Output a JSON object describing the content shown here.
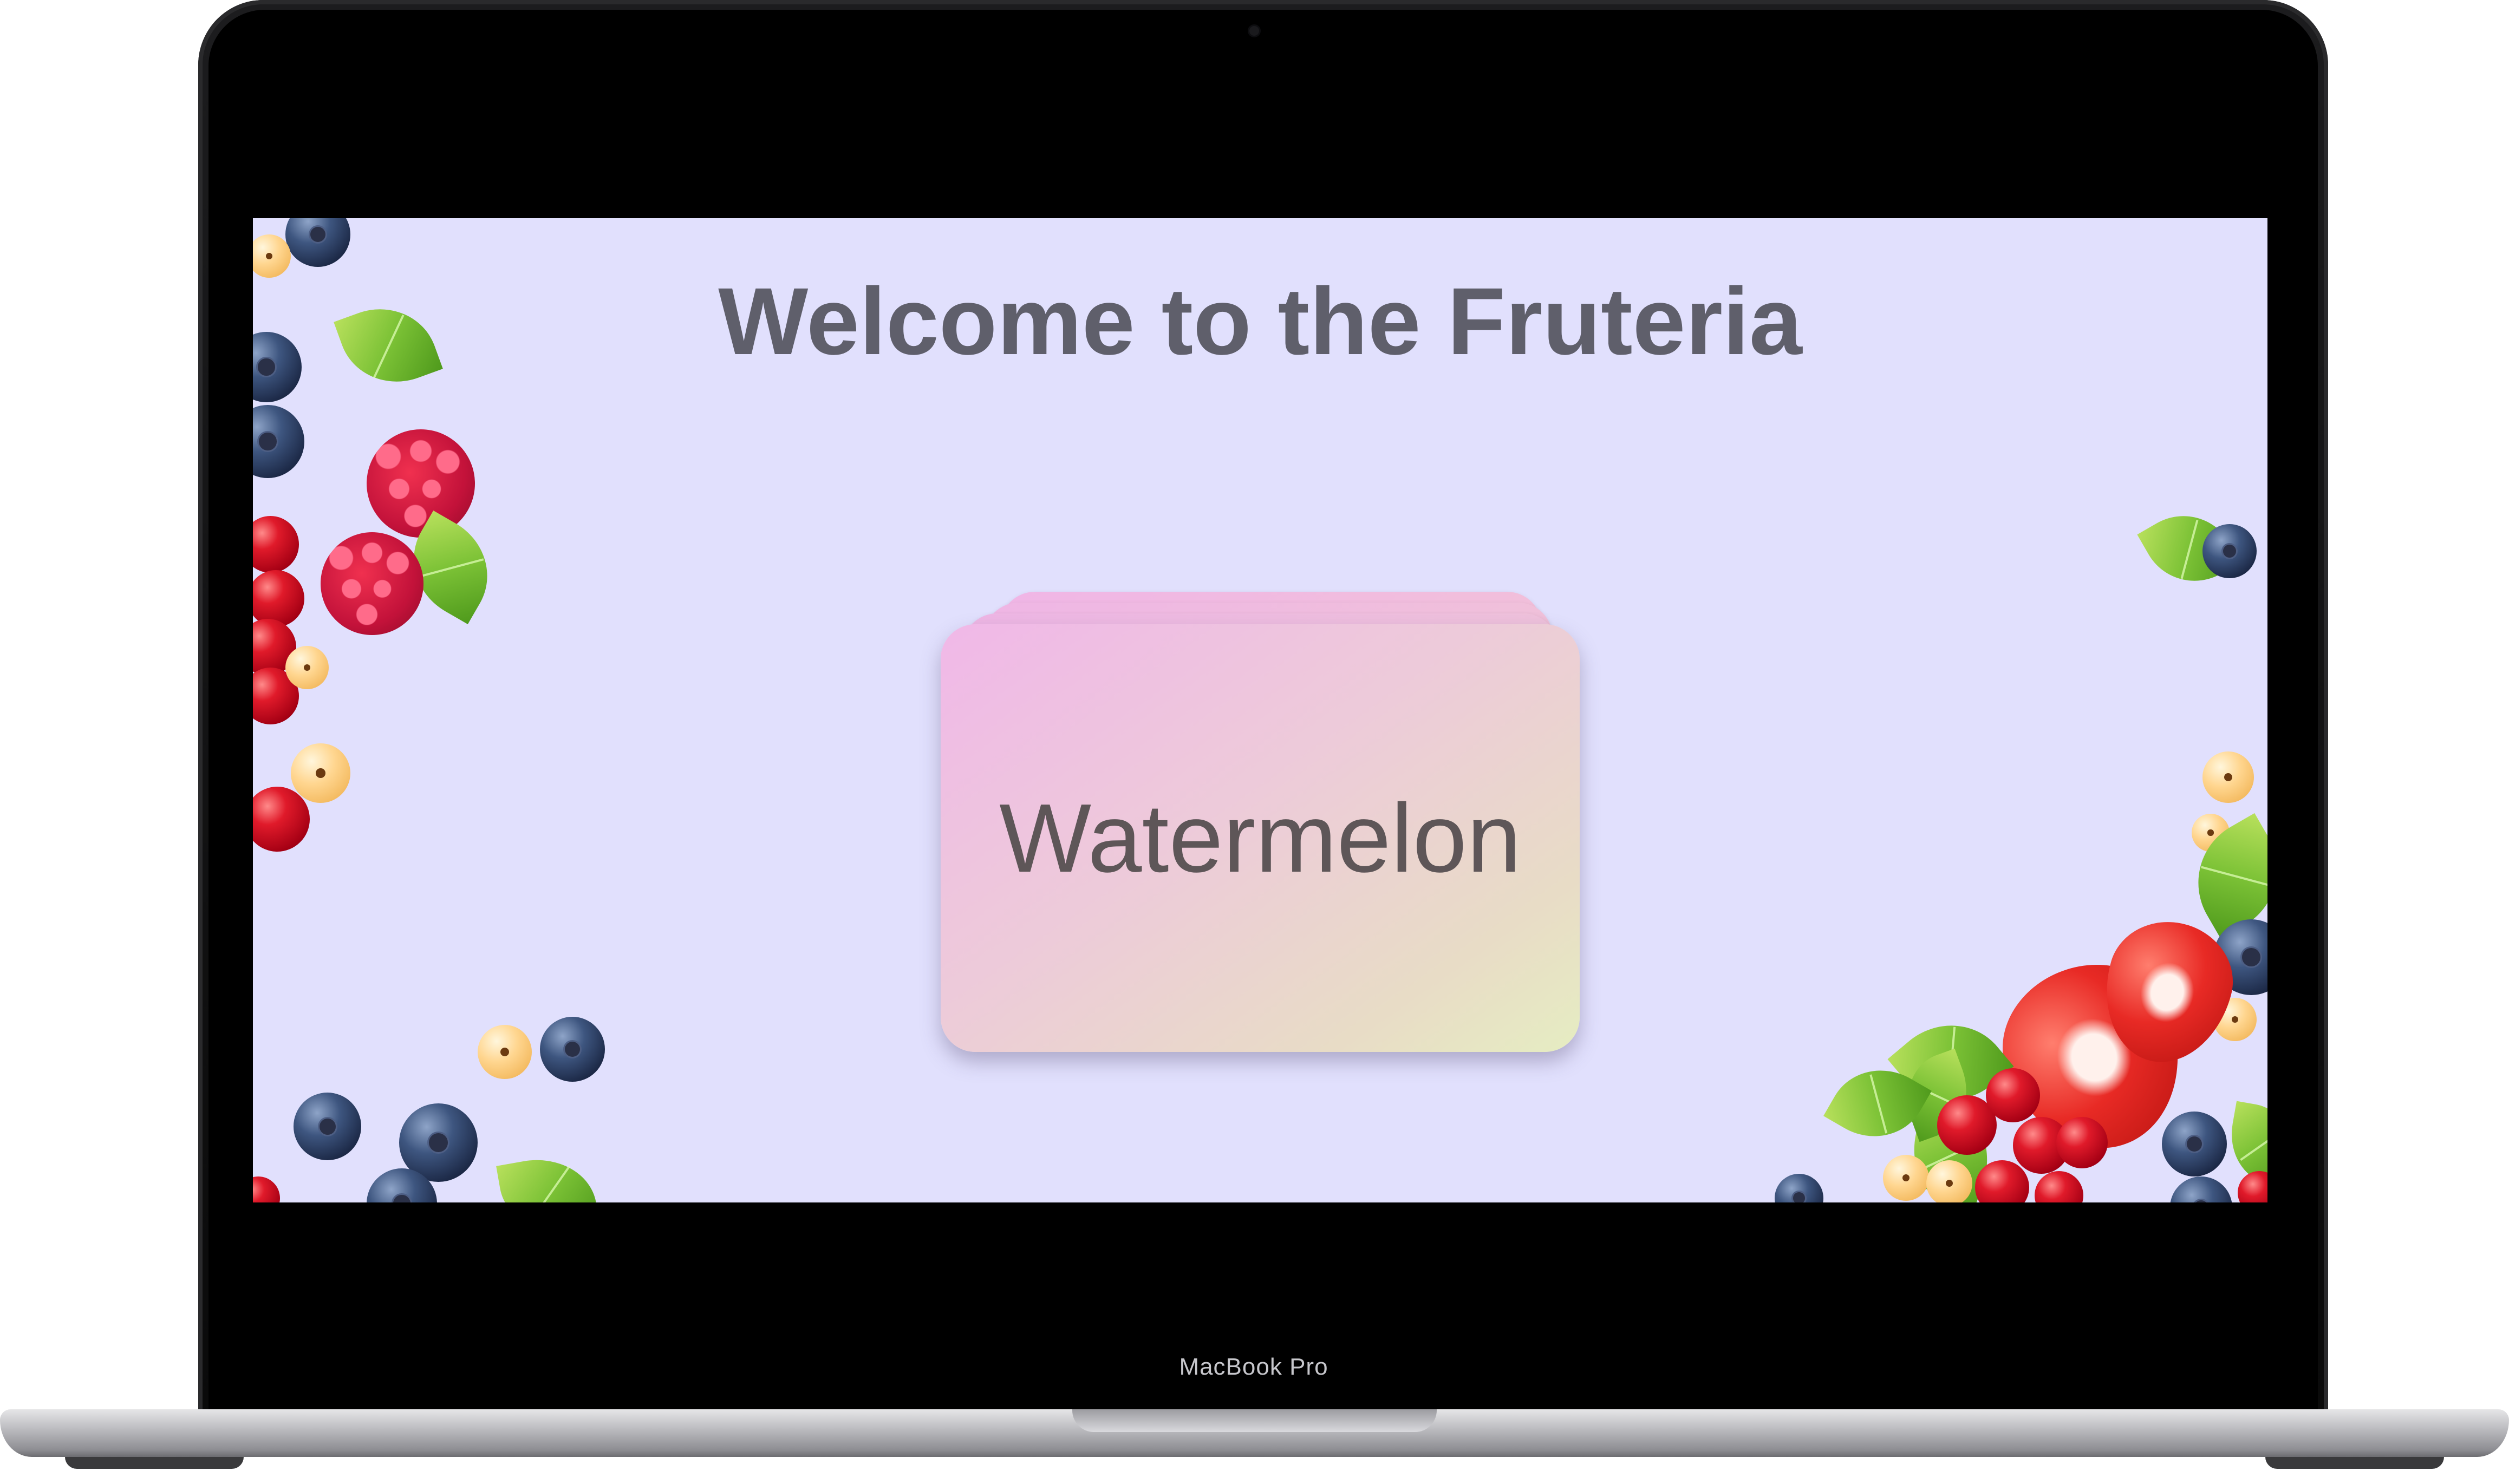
{
  "device": {
    "model_label": "MacBook Pro"
  },
  "page": {
    "title": "Welcome to the Fruteria",
    "card": {
      "label": "Watermelon"
    }
  },
  "colors": {
    "background": "#e1e0fd",
    "title": "#5f5f6b",
    "card_gradient_start": "#f0b8e8",
    "card_gradient_end": "#e6edc2"
  }
}
